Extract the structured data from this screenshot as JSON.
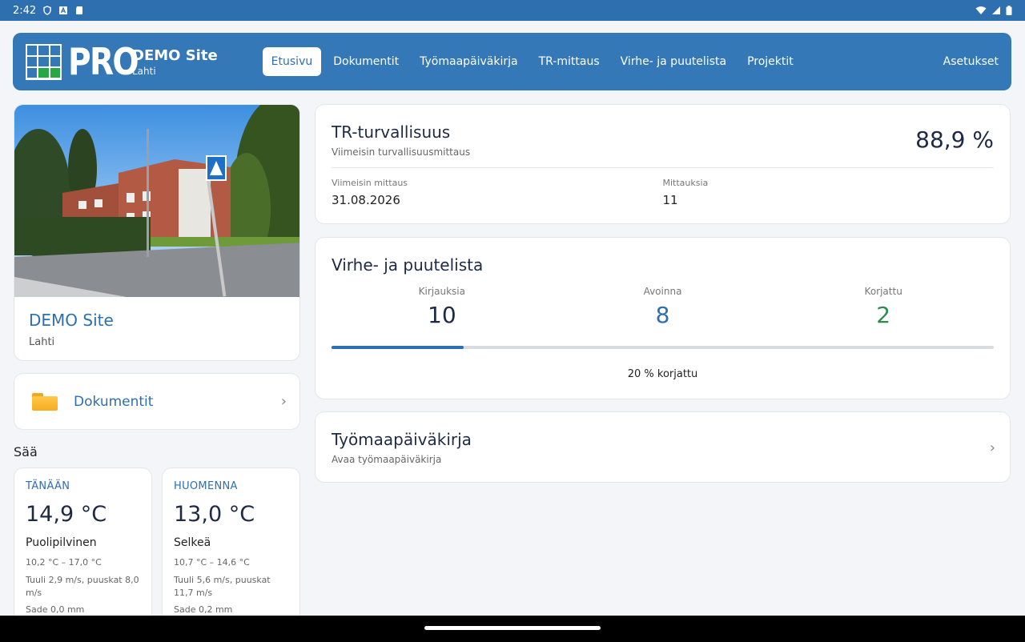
{
  "status_bar": {
    "time": "2:42"
  },
  "header": {
    "logo_text": "PRO",
    "site_name": "DEMO Site",
    "site_city": "Lahti",
    "tabs": [
      {
        "label": "Etusivu",
        "active": true
      },
      {
        "label": "Dokumentit",
        "active": false
      },
      {
        "label": "Työmaapäiväkirja",
        "active": false
      },
      {
        "label": "TR-mittaus",
        "active": false
      },
      {
        "label": "Virhe- ja puutelista",
        "active": false
      },
      {
        "label": "Projektit",
        "active": false
      }
    ],
    "settings_label": "Asetukset"
  },
  "site_card": {
    "title": "DEMO Site",
    "city": "Lahti"
  },
  "documents_card": {
    "label": "Dokumentit"
  },
  "weather": {
    "title": "Sää",
    "today": {
      "day": "TÄNÄÄN",
      "temp": "14,9 °C",
      "condition": "Puolipilvinen",
      "range": "10,2 °C – 17,0 °C",
      "wind": "Tuuli 2,9 m/s, puuskat 8,0 m/s",
      "rain": "Sade 0,0 mm"
    },
    "tomorrow": {
      "day": "HUOMENNA",
      "temp": "13,0 °C",
      "condition": "Selkeä",
      "range": "10,7 °C – 14,6 °C",
      "wind": "Tuuli 5,6 m/s, puuskat 11,7 m/s",
      "rain": "Sade 0,2 mm"
    }
  },
  "tr_card": {
    "title": "TR-turvallisuus",
    "subtitle": "Viimeisin turvallisuusmittaus",
    "value": "88,9 %",
    "latest_label": "Viimeisin mittaus",
    "latest_value": "31.08.2026",
    "count_label": "Mittauksia",
    "count_value": "11"
  },
  "defects_card": {
    "title": "Virhe- ja puutelista",
    "entries_label": "Kirjauksia",
    "entries_value": "10",
    "open_label": "Avoinna",
    "open_value": "8",
    "fixed_label": "Korjattu",
    "fixed_value": "2",
    "fixed_fraction": 0.2,
    "footer": "20 % korjattu"
  },
  "diary_card": {
    "title": "Työmaapäiväkirja",
    "subtitle": "Avaa työmaapäiväkirja"
  },
  "colors": {
    "primary": "#3478b8",
    "green": "#2e8b4e",
    "background": "#f3f5f8"
  }
}
